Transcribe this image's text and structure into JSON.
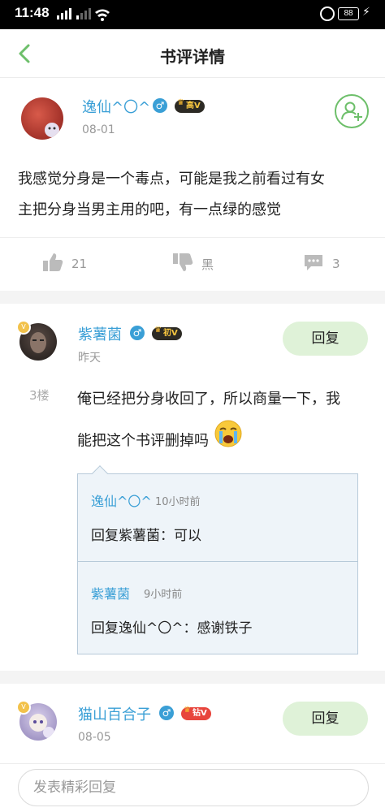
{
  "status_bar": {
    "time": "11:48",
    "battery": "88"
  },
  "header": {
    "title": "书评详情"
  },
  "review": {
    "author": "逸仙^〇^",
    "level_badge": "高V",
    "date": "08-01",
    "text_line1": "我感觉分身是一个毒点，可能是我之前看过有女",
    "text_line2": "主把分身当男主用的吧，有一点绿的感觉",
    "likes": "21",
    "dislike_label": "黑",
    "comments": "3"
  },
  "comment1": {
    "author": "紫薯菌",
    "level_badge": "初V",
    "date": "昨天",
    "floor": "3楼",
    "text_line1": "俺已经把分身收回了，所以商量一下，我",
    "text_line2": "能把这个书评删掉吗",
    "reply_label": "回复",
    "subreplies": [
      {
        "author": "逸仙^〇^",
        "time": "10小时前",
        "text": "回复紫薯菌：可以"
      },
      {
        "author": "紫薯菌",
        "time": "9小时前",
        "text": "回复逸仙^〇^：感谢铁子"
      }
    ]
  },
  "comment2": {
    "author": "猫山百合子",
    "level_badge": "钻V",
    "date": "08-05",
    "reply_label": "回复"
  },
  "input": {
    "placeholder": "发表精彩回复"
  },
  "colors": {
    "accent_green": "#6dbf6a",
    "name_blue": "#3a9fd6",
    "reply_bg": "#dff2d8"
  }
}
